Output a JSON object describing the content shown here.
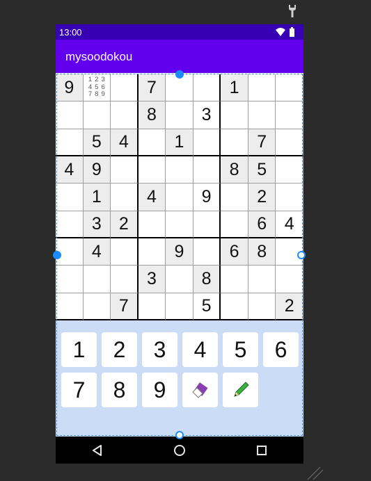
{
  "status_bar": {
    "time": "13:00"
  },
  "app_bar": {
    "title": "mysoodokou"
  },
  "board": {
    "cells": [
      [
        "9",
        "",
        "",
        "7",
        "",
        "",
        "1",
        "",
        ""
      ],
      [
        "",
        "",
        "",
        "8",
        "",
        "3",
        "",
        "",
        ""
      ],
      [
        "",
        "5",
        "4",
        "",
        "1",
        "",
        "",
        "7",
        ""
      ],
      [
        "4",
        "9",
        "",
        "",
        "",
        "",
        "8",
        "5",
        ""
      ],
      [
        "",
        "1",
        "",
        "4",
        "",
        "9",
        "",
        "2",
        ""
      ],
      [
        "",
        "3",
        "2",
        "",
        "",
        "",
        "",
        "6",
        "4"
      ],
      [
        "",
        "4",
        "",
        "",
        "9",
        "",
        "6",
        "8",
        ""
      ],
      [
        "",
        "",
        "",
        "3",
        "",
        "8",
        "",
        "",
        ""
      ],
      [
        "",
        "",
        "7",
        "",
        "",
        "5",
        "",
        "",
        "2"
      ]
    ],
    "given": [
      [
        1,
        0,
        0,
        1,
        0,
        0,
        1,
        0,
        0
      ],
      [
        0,
        0,
        0,
        1,
        0,
        0,
        0,
        0,
        0
      ],
      [
        0,
        1,
        1,
        0,
        1,
        0,
        0,
        1,
        0
      ],
      [
        1,
        1,
        0,
        0,
        0,
        0,
        1,
        1,
        0
      ],
      [
        0,
        1,
        0,
        1,
        0,
        0,
        0,
        1,
        0
      ],
      [
        0,
        1,
        1,
        0,
        0,
        0,
        0,
        1,
        0
      ],
      [
        0,
        1,
        0,
        0,
        1,
        0,
        1,
        1,
        0
      ],
      [
        0,
        0,
        0,
        1,
        0,
        1,
        0,
        0,
        0
      ],
      [
        0,
        0,
        1,
        0,
        0,
        0,
        0,
        0,
        1
      ]
    ],
    "notes_cell": {
      "row": 0,
      "col": 1,
      "notes": [
        "1",
        "2",
        "3",
        "4",
        "5",
        "6",
        "7",
        "8",
        "9"
      ]
    }
  },
  "keypad": {
    "digits": [
      "1",
      "2",
      "3",
      "4",
      "5",
      "6",
      "7",
      "8",
      "9"
    ],
    "tools": [
      {
        "name": "eraser",
        "icon": "eraser-icon"
      },
      {
        "name": "pencil",
        "icon": "pencil-icon"
      }
    ]
  },
  "navigation": {
    "buttons": [
      "back",
      "home",
      "recents"
    ]
  },
  "colors": {
    "status_bar": "#3700b3",
    "app_bar": "#6200ee",
    "given_cell": "#ededed",
    "keypad_bg": "#cbdcf6",
    "selection": "#1a8cff"
  }
}
